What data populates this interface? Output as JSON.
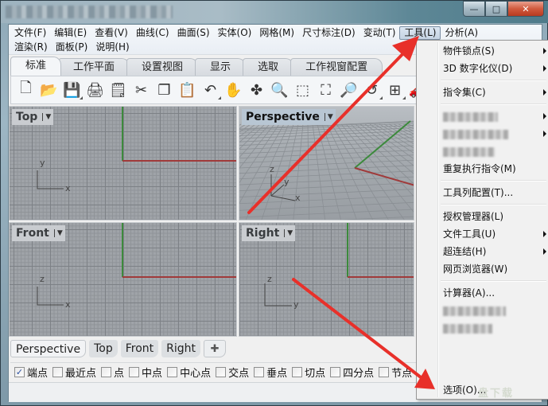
{
  "window": {
    "title": "",
    "controls": {
      "minimize": "—",
      "maximize": "□",
      "close": "✕"
    }
  },
  "menubar": {
    "row1": [
      "文件(F)",
      "编辑(E)",
      "查看(V)",
      "曲线(C)",
      "曲面(S)",
      "实体(O)",
      "网格(M)",
      "尺寸标注(D)",
      "变动(T)",
      "工具(L)",
      "分析(A)"
    ],
    "row2": [
      "渲染(R)",
      "面板(P)",
      "说明(H)"
    ],
    "active": "工具(L)"
  },
  "tabs": [
    "标准",
    "工作平面",
    "设置视图",
    "显示",
    "选取",
    "工作视窗配置"
  ],
  "active_tab": "标准",
  "toolbar": {
    "tools": [
      {
        "name": "new-file-icon",
        "glyph": "🗋"
      },
      {
        "name": "open-folder-icon",
        "glyph": "📂"
      },
      {
        "name": "save-icon",
        "glyph": "💾"
      },
      {
        "name": "print-icon",
        "glyph": "🖨"
      },
      {
        "name": "import-icon",
        "glyph": "🗒"
      },
      {
        "name": "cut-icon",
        "glyph": "✂"
      },
      {
        "name": "copy-icon",
        "glyph": "❐"
      },
      {
        "name": "paste-icon",
        "glyph": "📋"
      },
      {
        "name": "undo-icon",
        "glyph": "↶"
      },
      {
        "name": "pan-hand-icon",
        "glyph": "✋"
      },
      {
        "name": "rotate-view-icon",
        "glyph": "✤"
      },
      {
        "name": "zoom-dynamic-icon",
        "glyph": "🔍"
      },
      {
        "name": "zoom-window-icon",
        "glyph": "⬚"
      },
      {
        "name": "zoom-extents-icon",
        "glyph": "⛶"
      },
      {
        "name": "zoom-selected-icon",
        "glyph": "🔎"
      },
      {
        "name": "undo-view-icon",
        "glyph": "↺"
      },
      {
        "name": "four-viewports-icon",
        "glyph": "⊞"
      },
      {
        "name": "render-car-icon",
        "glyph": "🚗"
      }
    ]
  },
  "viewports": {
    "top": {
      "label": "Top",
      "axes": [
        "y",
        "x"
      ]
    },
    "perspective": {
      "label": "Perspective",
      "axes": [
        "z",
        "y",
        "x"
      ]
    },
    "front": {
      "label": "Front",
      "axes": [
        "z",
        "x"
      ]
    },
    "right": {
      "label": "Right",
      "axes": [
        "z",
        "y"
      ]
    }
  },
  "viewport_tabs": [
    "Perspective",
    "Top",
    "Front",
    "Right"
  ],
  "viewport_tab_add": "✚",
  "osnaps": [
    {
      "label": "端点",
      "checked": true
    },
    {
      "label": "最近点",
      "checked": false
    },
    {
      "label": "点",
      "checked": false
    },
    {
      "label": "中点",
      "checked": false
    },
    {
      "label": "中心点",
      "checked": false
    },
    {
      "label": "交点",
      "checked": false
    },
    {
      "label": "垂点",
      "checked": false
    },
    {
      "label": "切点",
      "checked": false
    },
    {
      "label": "四分点",
      "checked": false
    },
    {
      "label": "节点",
      "checked": false
    }
  ],
  "tools_menu": {
    "items": [
      {
        "label": "物件锁点(S)",
        "submenu": true
      },
      {
        "label": "3D 数字化仪(D)",
        "submenu": true
      },
      {
        "label": "指令集(C)",
        "submenu": true
      },
      {
        "label": "",
        "submenu": true,
        "blurred": true
      },
      {
        "label": "",
        "submenu": true,
        "blurred": true
      },
      {
        "label": "",
        "submenu": false,
        "blurred": true
      },
      {
        "label": "重复执行指令(M)",
        "submenu": false
      },
      {
        "label": "工具列配置(T)...",
        "submenu": false
      },
      {
        "label": "授权管理器(L)",
        "submenu": false
      },
      {
        "label": "文件工具(U)",
        "submenu": true
      },
      {
        "label": "超连结(H)",
        "submenu": true
      },
      {
        "label": "网页浏览器(W)",
        "submenu": false
      },
      {
        "label": "计算器(A)...",
        "submenu": false
      },
      {
        "label": "",
        "submenu": false,
        "blurred": true
      },
      {
        "label": "",
        "submenu": false,
        "blurred": true
      },
      {
        "label": "选项(O)...",
        "submenu": false
      }
    ]
  },
  "watermark": "盘下载",
  "colors": {
    "x_axis": "#a03a3a",
    "y_axis": "#3c8a3c",
    "annotation_arrow": "#e8302a"
  }
}
